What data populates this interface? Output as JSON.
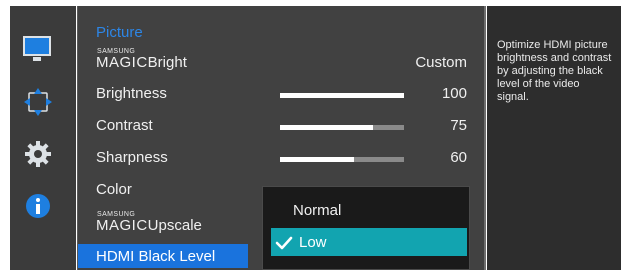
{
  "icons": {
    "picture": "monitor-icon",
    "position": "position-arrows-icon",
    "system": "gear-icon",
    "info": "info-icon"
  },
  "menu": {
    "title": "Picture",
    "magic_brand": "SAMSUNG",
    "magic_word": "MAGIC",
    "items": [
      {
        "label": "Bright",
        "value": "Custom"
      },
      {
        "label": "Brightness",
        "value": "100",
        "level": 100
      },
      {
        "label": "Contrast",
        "value": "75",
        "level": 75
      },
      {
        "label": "Sharpness",
        "value": "60",
        "level": 60
      },
      {
        "label": "Color"
      },
      {
        "label": "Upscale"
      },
      {
        "label": "HDMI Black Level"
      }
    ]
  },
  "dropdown": {
    "options": [
      "Normal",
      "Low"
    ],
    "selected": "Low"
  },
  "description": "Optimize HDMI picture brightness and contrast by adjusting the black level of the video signal.",
  "colors": {
    "accent": "#1a73dd",
    "title": "#2d86e6",
    "selected_option": "#12a4b0",
    "panel": "#414141"
  }
}
